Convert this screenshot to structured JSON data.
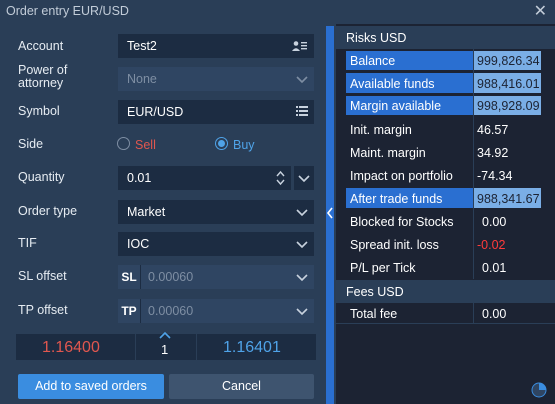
{
  "window": {
    "title": "Order entry  EUR/USD",
    "close": "✕"
  },
  "form": {
    "account": {
      "label": "Account",
      "value": "Test2"
    },
    "power_of_attorney": {
      "label_line1": "Power of",
      "label_line2": "attorney",
      "value": "None"
    },
    "symbol": {
      "label": "Symbol",
      "value": "EUR/USD"
    },
    "side": {
      "label": "Side",
      "sell": "Sell",
      "buy": "Buy",
      "selected": "Buy"
    },
    "quantity": {
      "label": "Quantity",
      "value": "0.01"
    },
    "order_type": {
      "label": "Order type",
      "value": "Market"
    },
    "tif": {
      "label": "TIF",
      "value": "IOC"
    },
    "sl_offset": {
      "label": "SL offset",
      "prefix": "SL",
      "placeholder": "0.00060"
    },
    "tp_offset": {
      "label": "TP offset",
      "prefix": "TP",
      "placeholder": "0.00060"
    }
  },
  "prices": {
    "bid": "1.16400",
    "qty": "1",
    "ask": "1.16401"
  },
  "buttons": {
    "save": "Add to saved orders",
    "cancel": "Cancel"
  },
  "risks": {
    "header": "Risks USD",
    "rows": [
      {
        "label": "Balance",
        "value": "999,826.34"
      },
      {
        "label": "Available  funds",
        "value": "988,416.01"
      },
      {
        "label": "Margin available",
        "value": "998,928.09"
      },
      {
        "label": "Init. margin",
        "value": "46.57"
      },
      {
        "label": "Maint. margin",
        "value": "34.92"
      },
      {
        "label": "Impact on portfolio",
        "value": "-74.34"
      },
      {
        "label": "After trade funds",
        "value": "988,341.67"
      },
      {
        "label": "Blocked for Stocks",
        "value": "0.00"
      },
      {
        "label": "Spread init. loss",
        "value": "-0.02"
      },
      {
        "label": "P/L per Tick",
        "value": "0.01"
      }
    ]
  },
  "fees": {
    "header": "Fees USD",
    "rows": [
      {
        "label": "Total fee",
        "value": "0.00"
      }
    ]
  },
  "colors": {
    "accent": "#3a8de0",
    "sell": "#e0574f",
    "buy": "#4fa3e8",
    "bid_price": "#e0574f",
    "ask_price": "#4fa3e8",
    "negative_red": "#ff3b3b"
  }
}
